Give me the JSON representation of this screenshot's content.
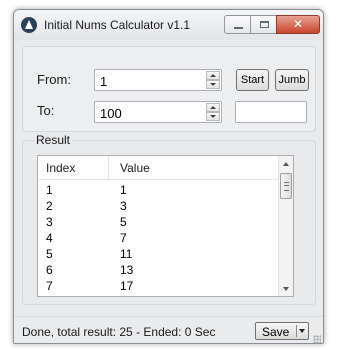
{
  "window": {
    "title": "Initial Nums Calculator v1.1",
    "close_glyph": "✕"
  },
  "inputs": {
    "from_label": "From:",
    "from_value": "1",
    "to_label": "To:",
    "to_value": "100"
  },
  "buttons": {
    "start_label": "Start",
    "jumb_label": "Jumb"
  },
  "result": {
    "group_title": "Result",
    "columns": [
      "Index",
      "Value"
    ],
    "rows": [
      [
        "1",
        "1"
      ],
      [
        "2",
        "3"
      ],
      [
        "3",
        "5"
      ],
      [
        "4",
        "7"
      ],
      [
        "5",
        "11"
      ],
      [
        "6",
        "13"
      ],
      [
        "7",
        "17"
      ]
    ]
  },
  "status": {
    "text": "Done, total result: 25 - Ended: 0 Sec",
    "save_label": "Save"
  }
}
